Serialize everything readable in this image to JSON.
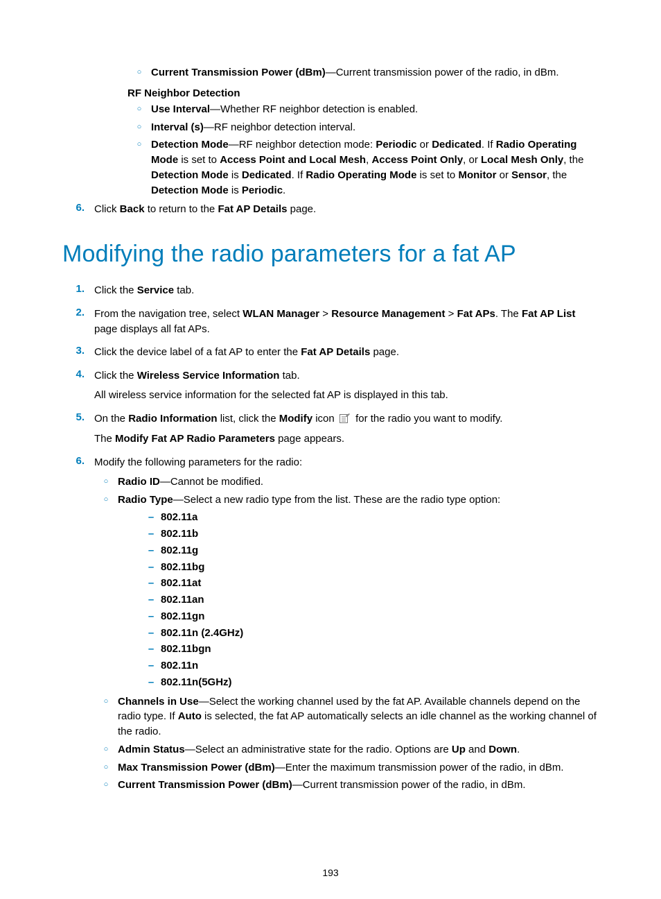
{
  "pageNumber": "193",
  "top": {
    "circ1_bold": "Current Transmission Power (dBm)",
    "circ1_text": "—Current transmission power of the radio, in dBm.",
    "rfHeader": "RF Neighbor Detection",
    "circ2_bold": "Use Interval",
    "circ2_text": "—Whether RF neighbor detection is enabled.",
    "circ3_bold": "Interval (s)",
    "circ3_text": "—RF neighbor detection interval.",
    "circ4_bold": "Detection Mode",
    "circ4_p1a": "—RF neighbor detection mode: ",
    "circ4_p1b": "Periodic",
    "circ4_p1c": " or ",
    "circ4_p1d": "Dedicated",
    "circ4_p1e": ". If ",
    "circ4_p1f": "Radio Operating Mode",
    "circ4_p1g": " is set to ",
    "circ4_p1h": "Access Point and Local Mesh",
    "circ4_p1i": ", ",
    "circ4_p1j": "Access Point Only",
    "circ4_p1k": ", or ",
    "circ4_p1l": "Local Mesh Only",
    "circ4_p1m": ", the ",
    "circ4_p1n": "Detection Mode",
    "circ4_p1o": " is ",
    "circ4_p1p": "Dedicated",
    "circ4_p1q": ". If ",
    "circ4_p1r": "Radio Operating Mode",
    "circ4_p1s": " is set to ",
    "circ4_p1t": "Monitor",
    "circ4_p1u": " or ",
    "circ4_p1v": "Sensor",
    "circ4_p1w": ", the ",
    "circ4_p1x": "Detection Mode",
    "circ4_p1y": " is ",
    "circ4_p1z": "Periodic",
    "circ4_p1end": ".",
    "step6a": "Click ",
    "step6b": "Back",
    "step6c": " to return to the ",
    "step6d": "Fat AP Details",
    "step6e": " page."
  },
  "heading": "Modifying the radio parameters for a fat AP",
  "steps": {
    "n1": "1.",
    "n2": "2.",
    "n3": "3.",
    "n4": "4.",
    "n5": "5.",
    "n6": "6.",
    "s1a": "Click the ",
    "s1b": "Service",
    "s1c": " tab.",
    "s2a": "From the navigation tree, select ",
    "s2b": "WLAN Manager",
    "s2gt1": " > ",
    "s2c": "Resource Management",
    "s2gt2": " > ",
    "s2d": "Fat APs",
    "s2e": ". The ",
    "s2f": "Fat AP List",
    "s2g": " page displays all fat APs.",
    "s3a": "Click the device label of a fat AP to enter the ",
    "s3b": "Fat AP Details",
    "s3c": " page.",
    "s4a": "Click the ",
    "s4b": "Wireless Service Information",
    "s4c": " tab.",
    "s4d": "All wireless service information for the selected fat AP is displayed in this tab.",
    "s5a": "On the ",
    "s5b": "Radio Information",
    "s5c": " list, click the ",
    "s5d": "Modify",
    "s5e": " icon ",
    "s5f": " for the radio you want to modify.",
    "s5g": "The ",
    "s5h": "Modify Fat AP Radio Parameters",
    "s5i": " page appears.",
    "s6a": "Modify the following parameters for the radio:"
  },
  "params": {
    "p1b": "Radio ID",
    "p1t": "—Cannot be modified.",
    "p2b": "Radio Type",
    "p2t": "—Select a new radio type from the list. These are the radio type option:",
    "radios": [
      "802.11a",
      "802.11b",
      "802.11g",
      "802.11bg",
      "802.11at",
      "802.11an",
      "802.11gn",
      "802.11n (2.4GHz)",
      "802.11bgn",
      "802.11n",
      "802.11n(5GHz)"
    ],
    "p3b": "Channels in Use",
    "p3t1": "—Select the working channel used by the fat AP. Available channels depend on the radio type. If ",
    "p3t2": "Auto",
    "p3t3": " is selected, the fat AP automatically selects an idle channel as the working channel of the radio.",
    "p4b": "Admin Status",
    "p4t1": "—Select an administrative state for the radio. Options are ",
    "p4t2": "Up",
    "p4t3": " and ",
    "p4t4": "Down",
    "p4t5": ".",
    "p5b": "Max Transmission Power (dBm)",
    "p5t": "—Enter the maximum transmission power of the radio, in dBm.",
    "p6b": "Current Transmission Power (dBm)",
    "p6t": "—Current transmission power of the radio, in dBm."
  }
}
